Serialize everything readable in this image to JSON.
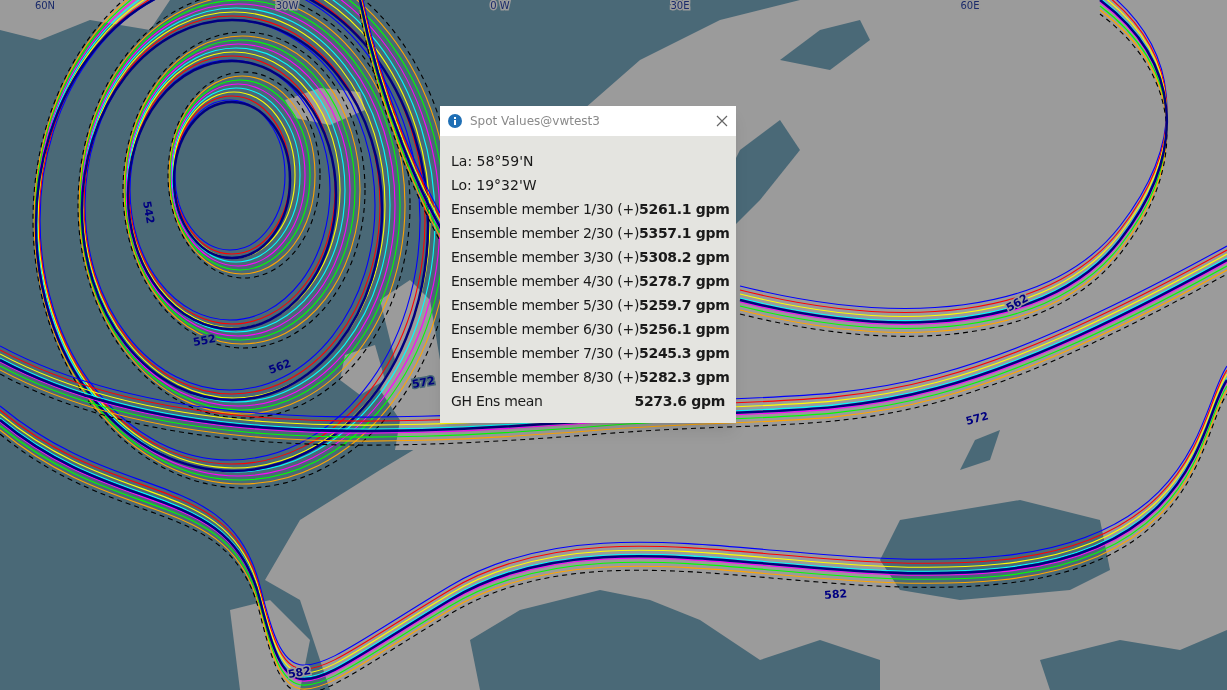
{
  "map": {
    "grid_labels": [
      {
        "text": "60N"
      },
      {
        "text": "30W"
      },
      {
        "text": "0 W"
      },
      {
        "text": "30E"
      },
      {
        "text": "60E"
      }
    ],
    "contour_labels": [
      {
        "text": "542"
      },
      {
        "text": "552"
      },
      {
        "text": "562"
      },
      {
        "text": "572"
      },
      {
        "text": "562"
      },
      {
        "text": "572"
      },
      {
        "text": "582"
      },
      {
        "text": "582"
      }
    ]
  },
  "popup": {
    "title": "Spot Values@vwtest3",
    "latitude": "La: 58°59'N",
    "longitude": "Lo: 19°32'W",
    "rows": [
      {
        "label": "Ensemble member 1/30 (+)",
        "value": "5261.1 gpm"
      },
      {
        "label": "Ensemble member 2/30 (+)",
        "value": "5357.1 gpm"
      },
      {
        "label": "Ensemble member 3/30 (+)",
        "value": "5308.2 gpm"
      },
      {
        "label": "Ensemble member 4/30 (+)",
        "value": "5278.7 gpm"
      },
      {
        "label": "Ensemble member 5/30 (+)",
        "value": "5259.7 gpm"
      },
      {
        "label": "Ensemble member 6/30 (+)",
        "value": "5256.1 gpm"
      },
      {
        "label": "Ensemble member 7/30 (+)",
        "value": "5245.3 gpm"
      },
      {
        "label": "Ensemble member 8/30 (+)",
        "value": "5282.3 gpm"
      },
      {
        "label": "GH Ens mean",
        "value": "5273.6 gpm"
      }
    ]
  }
}
